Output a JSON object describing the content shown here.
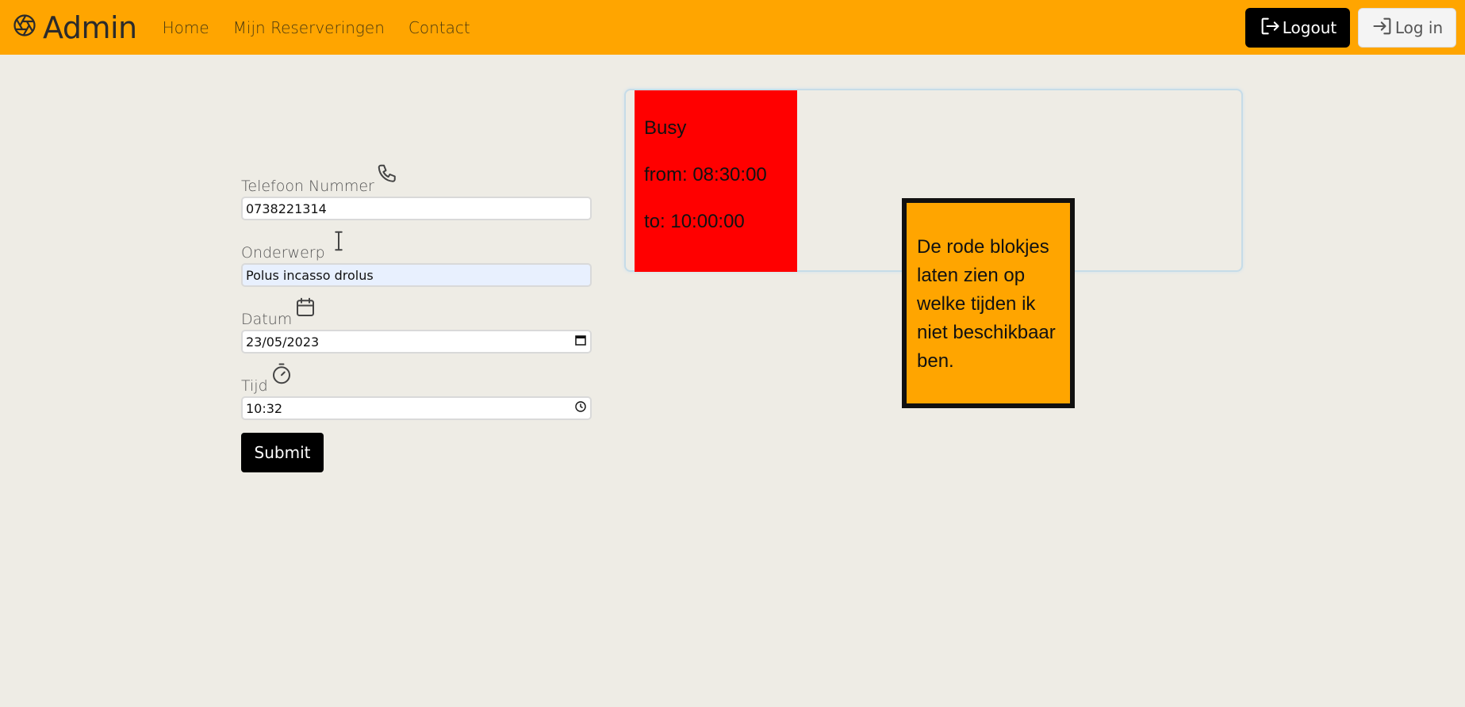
{
  "navbar": {
    "brand": "Admin",
    "links": [
      "Home",
      "Mijn Reserveringen",
      "Contact"
    ],
    "logout_label": "Logout",
    "login_label": "Log in",
    "color": "#ffa500"
  },
  "form": {
    "phone_label": "Telefoon Nummer",
    "phone_value": "0738221314",
    "subject_label": "Onderwerp",
    "subject_value": "Polus incasso drolus",
    "date_label": "Datum",
    "date_value": "23/05/2023",
    "time_label": "Tijd",
    "time_value": "10:32",
    "submit_label": "Submit"
  },
  "schedule": {
    "busy_title": "Busy",
    "busy_from": "from: 08:30:00",
    "busy_to": "to: 10:00:00",
    "busy_color": "#ff0000"
  },
  "note": {
    "text": "De rode blokjes laten zien op welke tijden ik niet beschikbaar ben."
  }
}
